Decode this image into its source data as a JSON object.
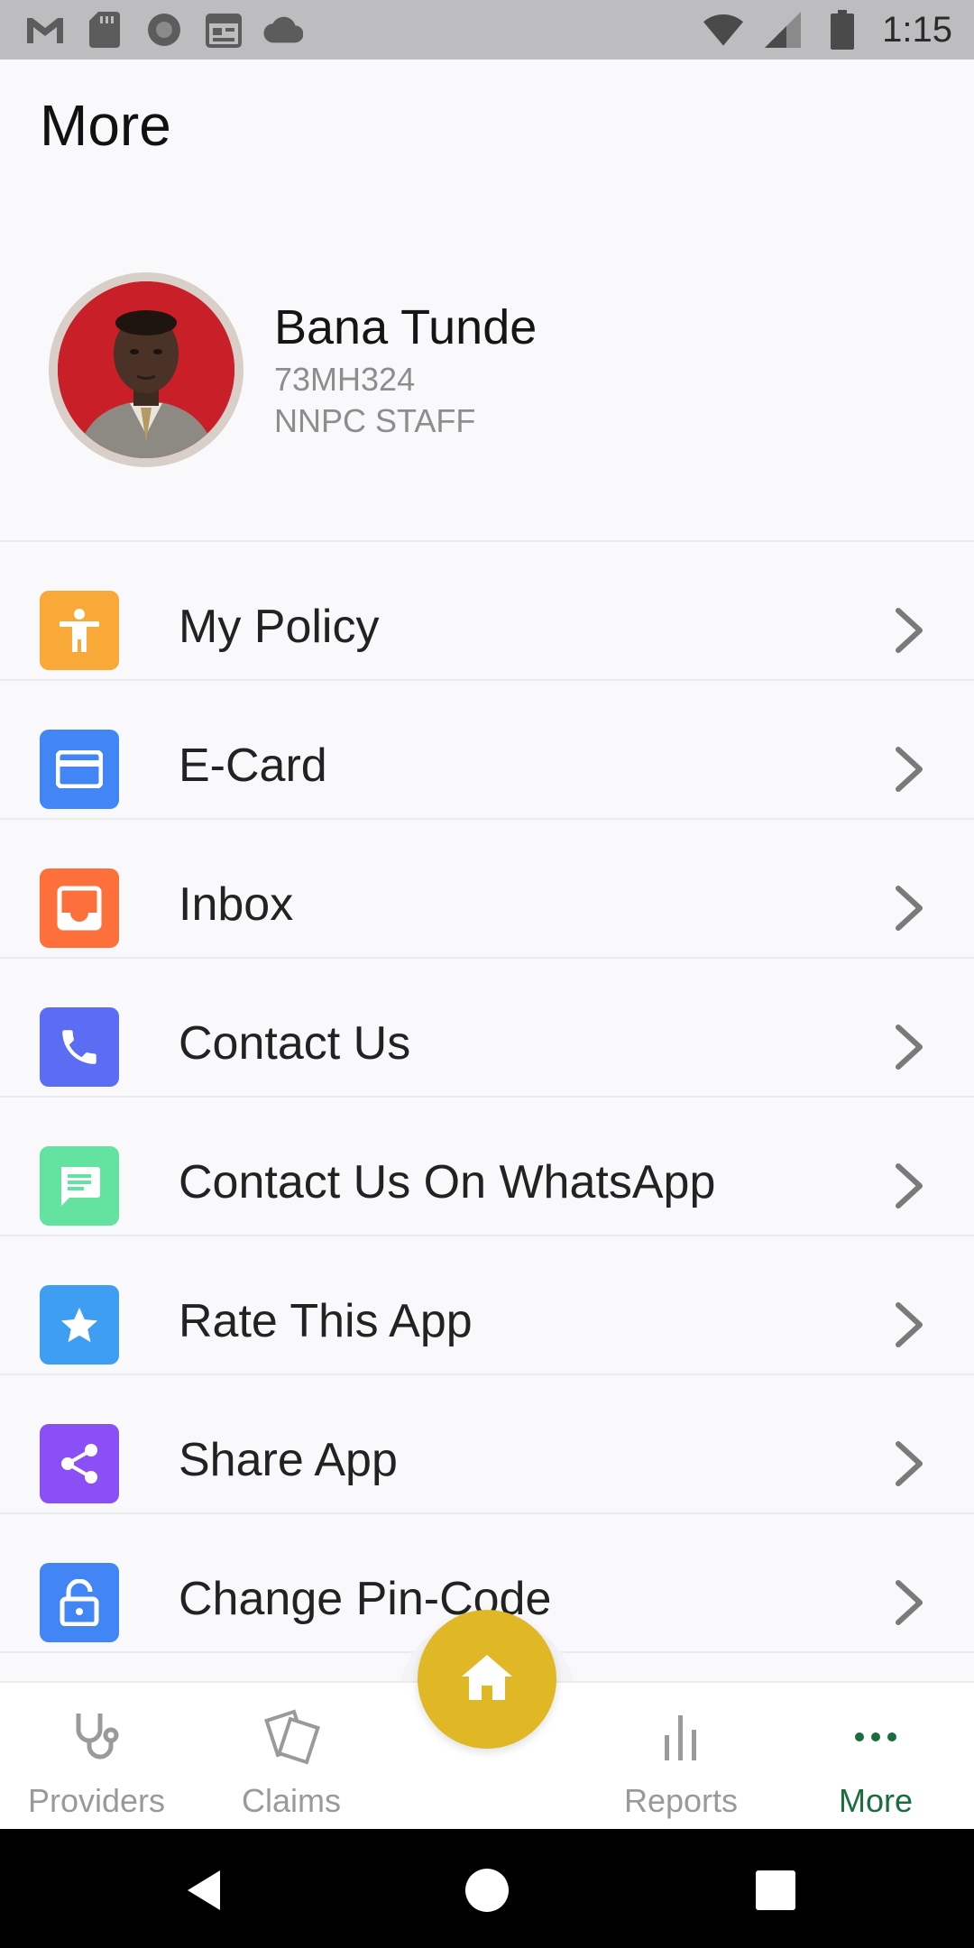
{
  "status_bar": {
    "time": "1:15",
    "left_icons": [
      "gmail-icon",
      "sd-card-icon",
      "record-icon",
      "calendar-icon",
      "cloud-icon"
    ],
    "right_icons": [
      "wifi-icon",
      "signal-icon",
      "battery-icon"
    ]
  },
  "header": {
    "title": "More"
  },
  "profile": {
    "name": "Bana Tunde",
    "member_id": "73MH324",
    "role": "NNPC STAFF"
  },
  "menu": [
    {
      "label": "My Policy",
      "icon": "accessibility-icon",
      "color": "#f9a937"
    },
    {
      "label": "E-Card",
      "icon": "credit-card-icon",
      "color": "#4285f4"
    },
    {
      "label": "Inbox",
      "icon": "inbox-icon",
      "color": "#fd6f3b"
    },
    {
      "label": "Contact Us",
      "icon": "phone-icon",
      "color": "#5b6df3"
    },
    {
      "label": "Contact Us On WhatsApp",
      "icon": "chat-icon",
      "color": "#63e2a0"
    },
    {
      "label": "Rate This App",
      "icon": "star-icon",
      "color": "#3e9ef2"
    },
    {
      "label": "Share App",
      "icon": "share-icon",
      "color": "#8a4ff5"
    },
    {
      "label": "Change Pin-Code",
      "icon": "lock-icon",
      "color": "#4285f4"
    }
  ],
  "bottom_nav": {
    "providers": "Providers",
    "claims": "Claims",
    "reports": "Reports",
    "more": "More",
    "active": "More",
    "active_color": "#1a6e3e",
    "fab_color": "#e0b725"
  }
}
